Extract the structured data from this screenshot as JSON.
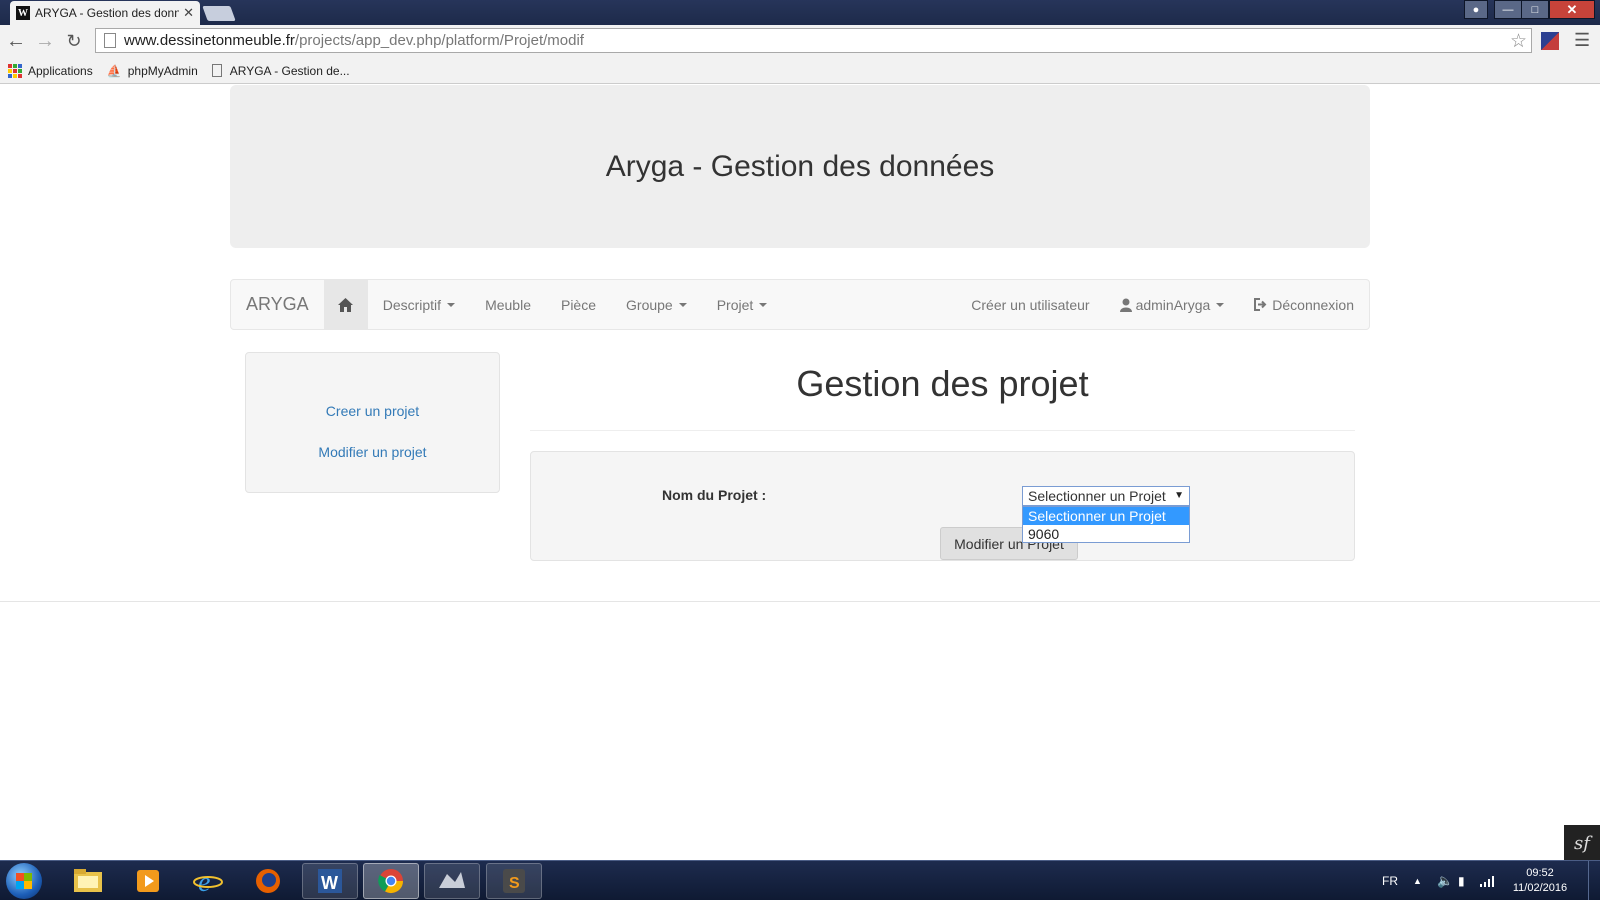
{
  "browser": {
    "tab_title": "ARYGA - Gestion des donn",
    "tab_favicon": "W",
    "tab_close": "✕",
    "url_host": "www.dessinetonmeuble.fr",
    "url_path": "/projects/app_dev.php/platform/Projet/modif"
  },
  "bookmarks": [
    {
      "label": "Applications",
      "icon": "apps-grid-icon"
    },
    {
      "label": "phpMyAdmin",
      "icon": "phpmyadmin-icon"
    },
    {
      "label": "ARYGA - Gestion de...",
      "icon": "page-icon"
    }
  ],
  "header": {
    "title": "Aryga - Gestion des données"
  },
  "navbar": {
    "brand": "ARYGA",
    "home_icon": "home-icon",
    "items": [
      {
        "label": "Descriptif",
        "dropdown": true
      },
      {
        "label": "Meuble",
        "dropdown": false
      },
      {
        "label": "Pièce",
        "dropdown": false
      },
      {
        "label": "Groupe",
        "dropdown": true
      },
      {
        "label": "Projet",
        "dropdown": true
      }
    ],
    "create_user": "Créer un utilisateur",
    "user": "adminAryga",
    "logout": "Déconnexion"
  },
  "sidebar": {
    "links": [
      "Creer un projet",
      "Modifier un projet"
    ]
  },
  "main": {
    "title": "Gestion des projet",
    "form_label": "Nom du Projet :",
    "select_value": "Selectionner un Projet",
    "select_options": [
      "Selectionner un Projet",
      "9060"
    ],
    "submit_label": "Modifier un Projet"
  },
  "taskbar": {
    "language": "FR",
    "time": "09:52",
    "date": "11/02/2016"
  },
  "colors": {
    "link": "#337ab7",
    "selected_option": "#3399ff",
    "jumbotron_bg": "#eeeeee",
    "navbar_bg": "#f8f8f8"
  }
}
